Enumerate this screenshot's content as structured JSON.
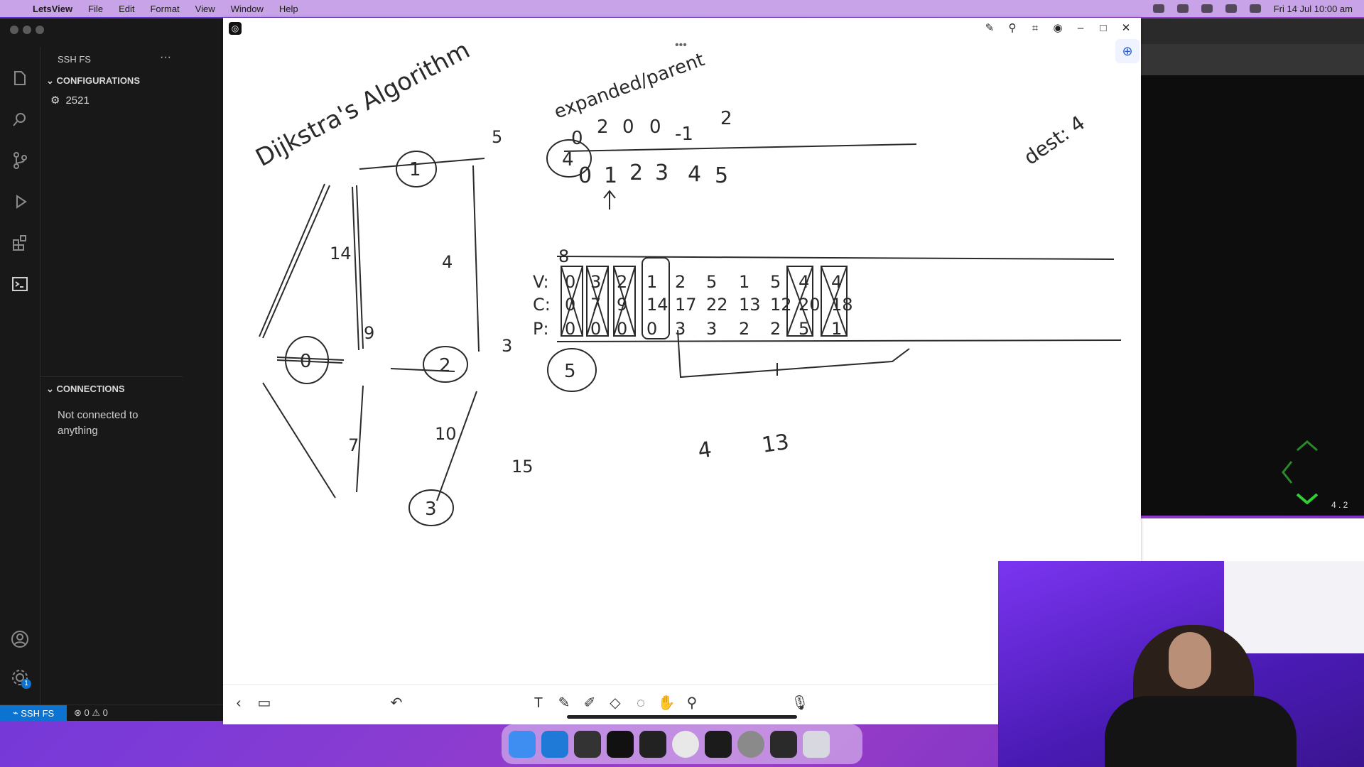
{
  "menubar": {
    "app": "LetsView",
    "items": [
      "File",
      "Edit",
      "Format",
      "View",
      "Window",
      "Help"
    ],
    "clock": "Fri 14 Jul  10:00 am"
  },
  "vscode": {
    "panel_title": "SSH FS",
    "more": "···",
    "configurations": {
      "heading": "CONFIGURATIONS",
      "items": [
        "2521"
      ]
    },
    "connections": {
      "heading": "CONNECTIONS",
      "empty": "Not connected to anything"
    },
    "status": {
      "remote": "SSH FS",
      "problems": "⊗ 0 ⚠ 0"
    },
    "badge": "1"
  },
  "whiteboard": {
    "title": "Dijkstra's Algorithm",
    "graph": {
      "nodes": [
        "0",
        "1",
        "2",
        "3",
        "4",
        "5"
      ],
      "edges": [
        {
          "from": "0",
          "to": "1",
          "weight": "14"
        },
        {
          "from": "0",
          "to": "2",
          "weight": "9"
        },
        {
          "from": "0",
          "to": "3",
          "weight": "7"
        },
        {
          "from": "1",
          "to": "4",
          "weight": "5"
        },
        {
          "from": "2",
          "to": "1",
          "weight": "4"
        },
        {
          "from": "2",
          "to": "5",
          "weight": "3"
        },
        {
          "from": "3",
          "to": "2",
          "weight": "10"
        },
        {
          "from": "3",
          "to": "5",
          "weight": "15"
        },
        {
          "from": "5",
          "to": "4",
          "weight": "8"
        }
      ]
    },
    "expanded_label": "expanded/parent",
    "expanded_row": [
      "0",
      "2",
      "0",
      "0",
      "-1",
      "2"
    ],
    "index_row": [
      "0",
      "1",
      "2",
      "3",
      "4",
      "5"
    ],
    "dest_label": "dest: 4",
    "table_labels": [
      "V:",
      "C:",
      "P:"
    ],
    "table": {
      "V": [
        "0",
        "3",
        "2",
        "1",
        "2",
        "5",
        "1",
        "5",
        "4",
        "4"
      ],
      "C": [
        "0",
        "7",
        "9",
        "14",
        "17",
        "22",
        "13",
        "12",
        "20",
        "18"
      ],
      "P": [
        "0",
        "0",
        "0",
        "0",
        "3",
        "3",
        "2",
        "2",
        "5",
        "1"
      ]
    },
    "scribble": [
      "4",
      "13"
    ],
    "page_indicator": "4 . 2"
  },
  "colors": {
    "menubar": "#c9a3e8",
    "vscode_bg": "#181818",
    "status_remote": "#0c73d1",
    "ink": "#2a2a2a"
  }
}
